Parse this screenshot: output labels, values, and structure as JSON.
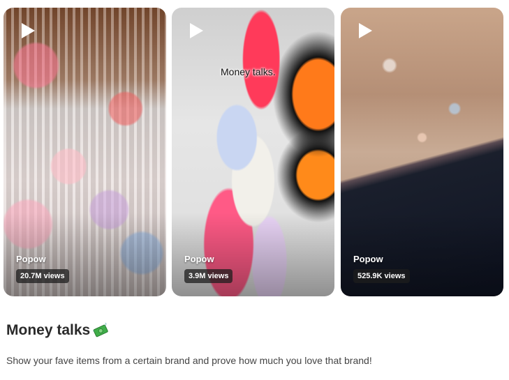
{
  "cards": [
    {
      "author": "Popow",
      "views": "20.7M views",
      "overlay_text": ""
    },
    {
      "author": "Popow",
      "views": "3.9M views",
      "overlay_text": "Money talks."
    },
    {
      "author": "Popow",
      "views": "525.9K views",
      "overlay_text": ""
    }
  ],
  "trend": {
    "title": "Money talks",
    "title_emoji_icon": "flying-money-icon",
    "description": "Show your fave items from a certain brand and prove how much you love that brand!"
  },
  "icons": {
    "play": "play-icon"
  },
  "colors": {
    "badge_bg": "#1e1e1e",
    "text": "#2a2a2a",
    "muted": "#444444"
  }
}
